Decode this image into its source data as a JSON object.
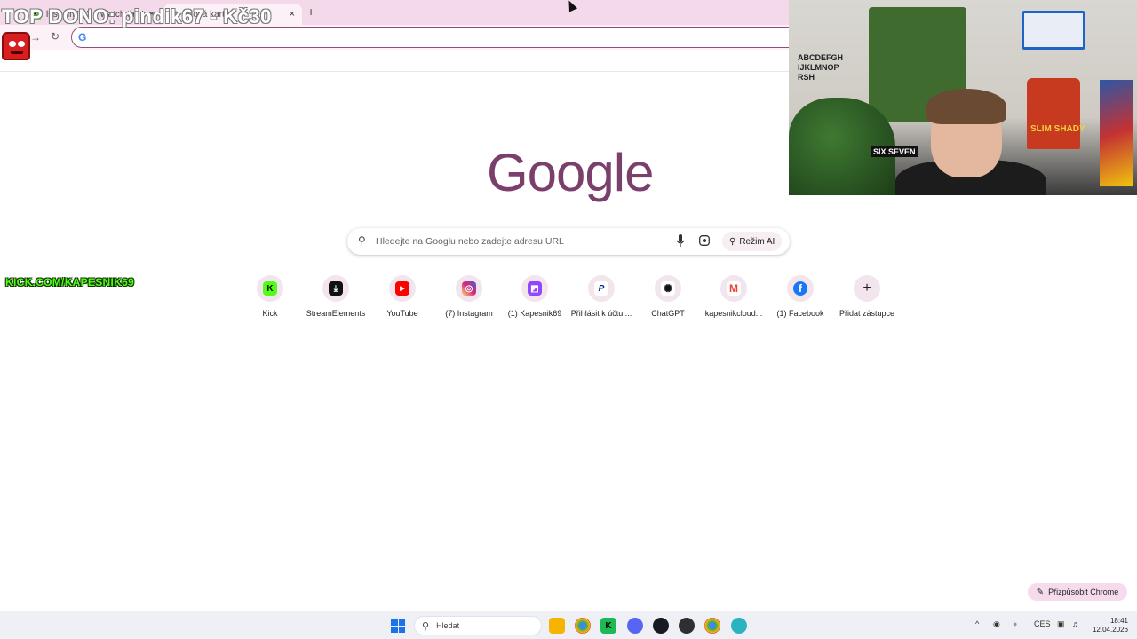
{
  "browser": {
    "tabs": [
      {
        "title": "lus... in \"Q\"... Watch the VOD",
        "favicon": "K"
      },
      {
        "title": "Nová karta",
        "favicon": "◍"
      }
    ],
    "tab_close": "×",
    "new_tab": "+",
    "back": "←",
    "forward": "→",
    "reload": "↻",
    "omnibox_icon": "G"
  },
  "overlay": {
    "top_donor": "TOP DONO: pindik67 - Kč30",
    "kick_url": "KICK.COM/KAPESNIK69"
  },
  "webcam": {
    "jersey_text": "SLIM SHADY",
    "wall_letters": "ABCDEFGH IJKLMNOP RSH",
    "board_text": "SIX SEVEN"
  },
  "ntp": {
    "logo": "Google",
    "search_placeholder": "Hledejte na Googlu nebo zadejte adresu URL",
    "ai_mode_label": "Režim AI",
    "customize_label": "Přizpůsobit Chrome",
    "shortcuts": [
      {
        "label": "Kick",
        "icon": "kick-icon",
        "glyph": "K",
        "color": "#53fc18",
        "fg": "#000000"
      },
      {
        "label": "StreamElements",
        "icon": "streamelements-icon",
        "glyph": "⤓",
        "color": "#111111",
        "fg": "#ffffff"
      },
      {
        "label": "YouTube",
        "icon": "youtube-icon",
        "glyph": "▶",
        "color": "#ff0000",
        "fg": "#ffffff"
      },
      {
        "label": "(7) Instagram",
        "icon": "instagram-icon",
        "glyph": "◎",
        "color": "#d6249f",
        "fg": "#ffffff"
      },
      {
        "label": "(1) Kapesnik69",
        "icon": "twitch-icon",
        "glyph": "◩",
        "color": "#9146ff",
        "fg": "#ffffff"
      },
      {
        "label": "Přihlásit k účtu ...",
        "icon": "paypal-icon",
        "glyph": "P",
        "color": "#ffffff",
        "fg": "#003087"
      },
      {
        "label": "ChatGPT",
        "icon": "chatgpt-icon",
        "glyph": "✺",
        "color": "#ffffff",
        "fg": "#111111"
      },
      {
        "label": "kapesnikcloud...",
        "icon": "gmail-icon",
        "glyph": "M",
        "color": "#ffffff",
        "fg": "#ea4335"
      },
      {
        "label": "(1) Facebook",
        "icon": "facebook-icon",
        "glyph": "f",
        "color": "#1877f2",
        "fg": "#ffffff"
      },
      {
        "label": "Přidat zástupce",
        "icon": "plus-icon",
        "glyph": "+",
        "color": "transparent",
        "fg": "#1f1f1f"
      }
    ]
  },
  "taskbar": {
    "search_placeholder": "Hledat",
    "apps": [
      {
        "name": "file-explorer-icon",
        "glyph": "▆",
        "color": "#f4b400"
      },
      {
        "name": "chrome-icon",
        "glyph": "◉",
        "color": "#34a853"
      },
      {
        "name": "kick-app-icon",
        "glyph": "K",
        "color": "#1db954"
      },
      {
        "name": "discord-icon",
        "glyph": "◕",
        "color": "#5865f2"
      },
      {
        "name": "steam-icon",
        "glyph": "◍",
        "color": "#171a21"
      },
      {
        "name": "obs-icon",
        "glyph": "◎",
        "color": "#302e31"
      },
      {
        "name": "chrome-profile-icon",
        "glyph": "◉",
        "color": "#4285f4"
      },
      {
        "name": "app-icon",
        "glyph": "◆",
        "color": "#2bb3c0"
      }
    ],
    "tray_chevron": "^",
    "language": "CES",
    "time": "18:41",
    "date": "12.04.2026"
  }
}
